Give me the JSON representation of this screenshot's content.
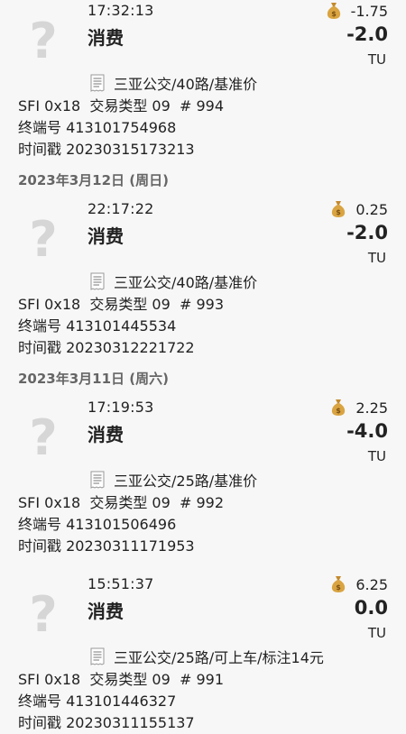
{
  "transactions": [
    {
      "date_header": "",
      "time": "17:32:13",
      "type": "消费",
      "balance": "-1.75",
      "amount": "-2.0",
      "unit": "TU",
      "merchant": "三亚公交/40路/基准价",
      "sfi_line": "SFI 0x18  交易类型 09  # 994",
      "terminal": "终端号 413101754968",
      "timestamp": "时间戳 20230315173213"
    },
    {
      "date_header": "2023年3月12日 (周日)",
      "time": "22:17:22",
      "type": "消费",
      "balance": "0.25",
      "amount": "-2.0",
      "unit": "TU",
      "merchant": "三亚公交/40路/基准价",
      "sfi_line": "SFI 0x18  交易类型 09  # 993",
      "terminal": "终端号 413101445534",
      "timestamp": "时间戳 20230312221722"
    },
    {
      "date_header": "2023年3月11日 (周六)",
      "time": "17:19:53",
      "type": "消费",
      "balance": "2.25",
      "amount": "-4.0",
      "unit": "TU",
      "merchant": "三亚公交/25路/基准价",
      "sfi_line": "SFI 0x18  交易类型 09  # 992",
      "terminal": "终端号 413101506496",
      "timestamp": "时间戳 20230311171953"
    },
    {
      "date_header": "",
      "time": "15:51:37",
      "type": "消费",
      "balance": "6.25",
      "amount": "0.0",
      "unit": "TU",
      "merchant": "三亚公交/25路/可上车/标注14元",
      "sfi_line": "SFI 0x18  交易类型 09  # 991",
      "terminal": "终端号 413101446327",
      "timestamp": "时间戳 20230311155137"
    }
  ],
  "icons": {
    "transaction_icon": "question-mark-icon",
    "balance_icon": "money-bag-icon",
    "merchant_icon": "receipt-icon"
  },
  "colors": {
    "background": "#f7f7f7",
    "text": "#222222",
    "date_header": "#666666",
    "icon_gray": "#d6d6d6",
    "money_bag": "#d9a441"
  }
}
